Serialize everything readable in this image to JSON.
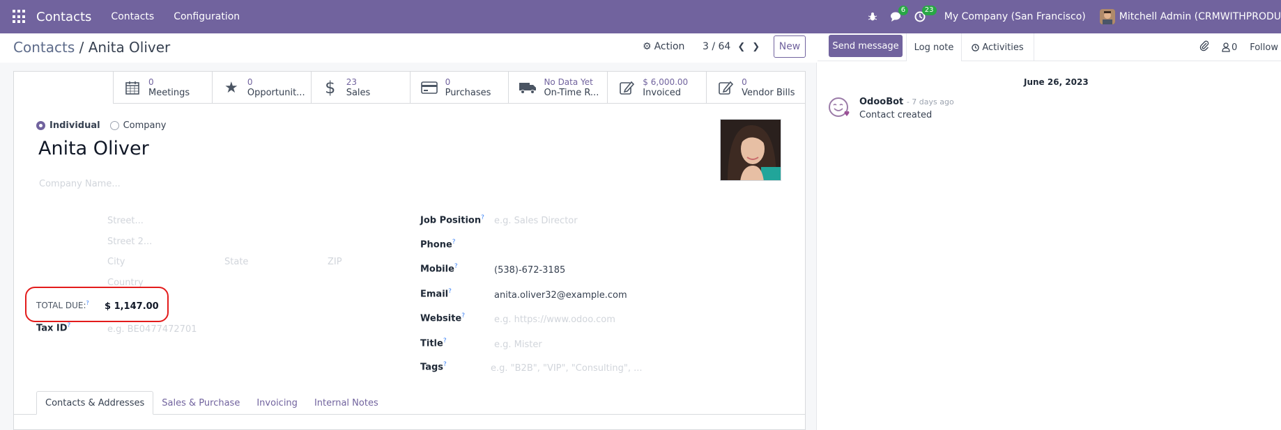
{
  "navbar": {
    "app_name": "Contacts",
    "menu": [
      "Contacts",
      "Configuration"
    ],
    "messages_badge": "6",
    "activities_badge": "23",
    "company": "My Company (San Francisco)",
    "user": "Mitchell Admin (CRMWITHPRODU",
    "accent_color": "#71639e"
  },
  "control_panel": {
    "breadcrumb_parent": "Contacts",
    "breadcrumb_sep": " / ",
    "breadcrumb_current": "Anita Oliver",
    "action_label": "Action",
    "pager": "3 / 64",
    "new_label": "New"
  },
  "smart_buttons": [
    {
      "icon": "calendar-icon",
      "value": "0",
      "label": "Meetings"
    },
    {
      "icon": "star-icon",
      "value": "0",
      "label": "Opportunit..."
    },
    {
      "icon": "dollar-icon",
      "value": "23",
      "label": "Sales"
    },
    {
      "icon": "credit-card-icon",
      "value": "0",
      "label": "Purchases"
    },
    {
      "icon": "truck-icon",
      "value": "No Data Yet",
      "label": "On-Time R..."
    },
    {
      "icon": "edit-icon",
      "value": "$ 6,000.00",
      "label": "Invoiced"
    },
    {
      "icon": "edit-icon",
      "value": "0",
      "label": "Vendor Bills"
    }
  ],
  "form": {
    "type_individual": "Individual",
    "type_company": "Company",
    "name": "Anita Oliver",
    "company_placeholder": "Company Name...",
    "street_placeholder": "Street...",
    "street2_placeholder": "Street 2...",
    "city_placeholder": "City",
    "state_placeholder": "State",
    "zip_placeholder": "ZIP",
    "country_placeholder": "Country",
    "total_due_label": "TOTAL DUE:",
    "total_due_value": "$ 1,147.00",
    "tax_id_label": "Tax ID",
    "tax_id_placeholder": "e.g. BE0477472701",
    "job_position_label": "Job Position",
    "job_position_placeholder": "e.g. Sales Director",
    "phone_label": "Phone",
    "mobile_label": "Mobile",
    "mobile_value": "(538)-672-3185",
    "email_label": "Email",
    "email_value": "anita.oliver32@example.com",
    "website_label": "Website",
    "website_placeholder": "e.g. https://www.odoo.com",
    "title_label": "Title",
    "title_placeholder": "e.g. Mister",
    "tags_label": "Tags",
    "tags_placeholder": "e.g. \"B2B\", \"VIP\", \"Consulting\", ...",
    "help_mark": "?"
  },
  "tabs": [
    "Contacts & Addresses",
    "Sales & Purchase",
    "Invoicing",
    "Internal Notes"
  ],
  "chatter": {
    "send_message": "Send message",
    "log_note": "Log note",
    "activities": "Activities",
    "followers_count": "0",
    "follow": "Follow",
    "date": "June 26, 2023",
    "author": "OdooBot",
    "time": "- 7 days ago",
    "body": "Contact created"
  }
}
